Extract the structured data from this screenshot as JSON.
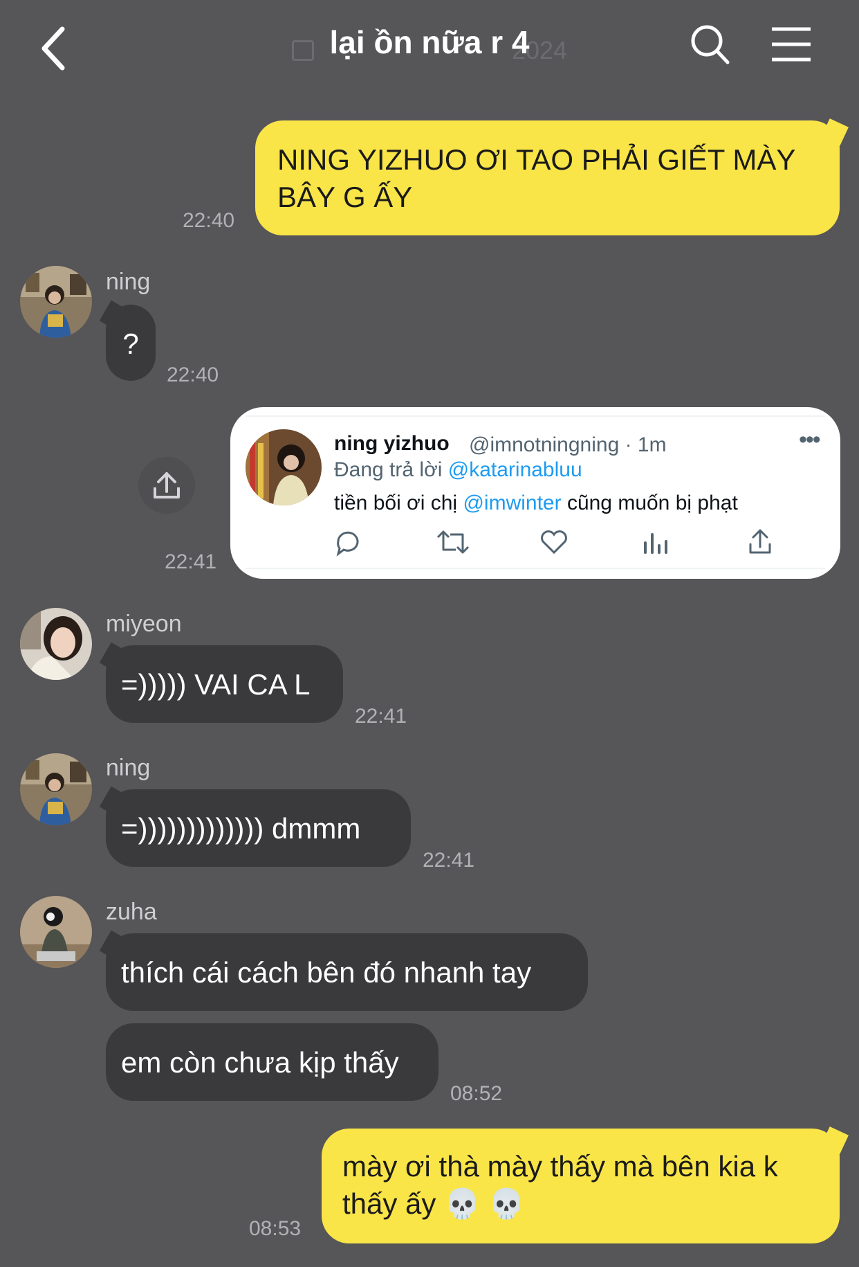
{
  "header": {
    "title": "lại ồn nữa r 4",
    "date_ghost": "2024"
  },
  "colors": {
    "background": "#565558",
    "my_bubble": "#f9e547",
    "other_bubble": "#3a393c",
    "link": "#1d9bf0"
  },
  "messages": {
    "m1": {
      "text": "NING YIZHUO ƠI TAO PHẢI GIẾT MÀY BÂY G ẤY",
      "time": "22:40"
    },
    "m2": {
      "sender": "ning",
      "text": "?",
      "time": "22:40"
    },
    "m3": {
      "time": "22:41",
      "tweet": {
        "name": "ning yizhuo",
        "handle": "@imnotningning · 1m",
        "reply_prefix": "Đang trả lời",
        "reply_to": "@katarinabluu",
        "text_before": "tiền bối ơi chị",
        "mention": "@imwinter",
        "text_after": "cũng muốn bị phạt",
        "actions": [
          "reply-icon",
          "retweet-icon",
          "like-icon",
          "views-icon",
          "share-icon"
        ]
      }
    },
    "m4": {
      "sender": "miyeon",
      "text": "=))))) VAI CA L",
      "time": "22:41"
    },
    "m5": {
      "sender": "ning",
      "text": "=))))))))))))) dmmm",
      "time": "22:41"
    },
    "m6": {
      "sender": "zuha",
      "text": "thích cái cách bên đó nhanh tay"
    },
    "m7": {
      "text": "em còn chưa kịp thấy",
      "time": "08:52"
    },
    "m8": {
      "text": "mày ơi thà mày thấy mà bên kia k thấy ấy 💀 💀",
      "time": "08:53"
    }
  }
}
